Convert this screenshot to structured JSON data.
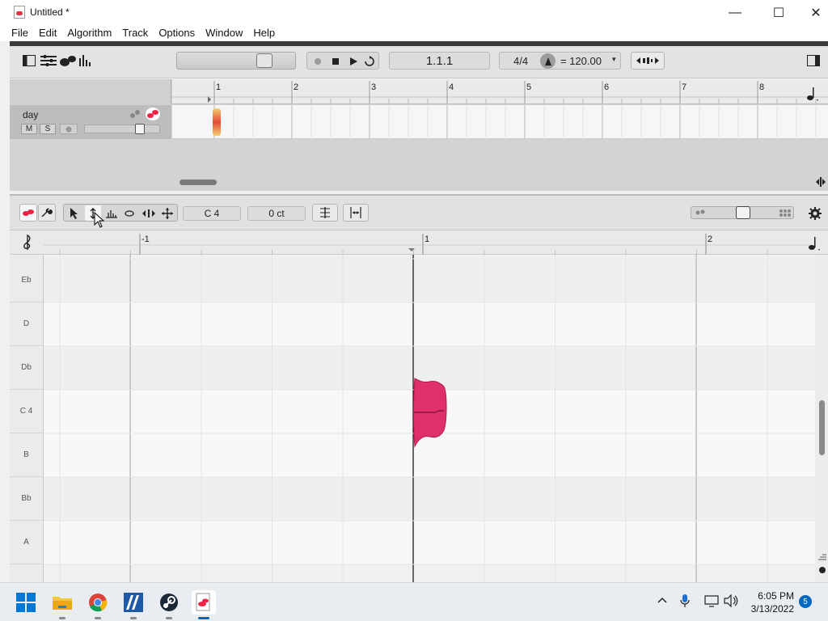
{
  "window": {
    "title": "Untitled *",
    "controls": {
      "minimize": "—",
      "maximize": "☐",
      "close": "✕"
    }
  },
  "menu": [
    "File",
    "Edit",
    "Algorithm",
    "Track",
    "Options",
    "Window",
    "Help"
  ],
  "toolbar": {
    "position": "1.1.1",
    "time_signature": "4/4",
    "tempo": "= 120.00"
  },
  "tracks": {
    "ruler_bars": [
      "1",
      "2",
      "3",
      "4",
      "5",
      "6",
      "7",
      "8"
    ],
    "track": {
      "name": "day",
      "mute_label": "M",
      "solo_label": "S"
    }
  },
  "editor": {
    "pitch_field": "C 4",
    "cents_field": "0 ct",
    "ruler_marks": [
      "-1",
      "1",
      "2"
    ],
    "pitch_rows": [
      "Eb",
      "D",
      "Db",
      "C 4",
      "B",
      "Bb",
      "A"
    ]
  },
  "taskbar": {
    "clock_time": "6:05 PM",
    "clock_date": "3/13/2022",
    "notification_count": "5"
  },
  "colors": {
    "blob": "#e0306a",
    "blob_dark": "#b01d4a",
    "accent": "#0067c0"
  }
}
